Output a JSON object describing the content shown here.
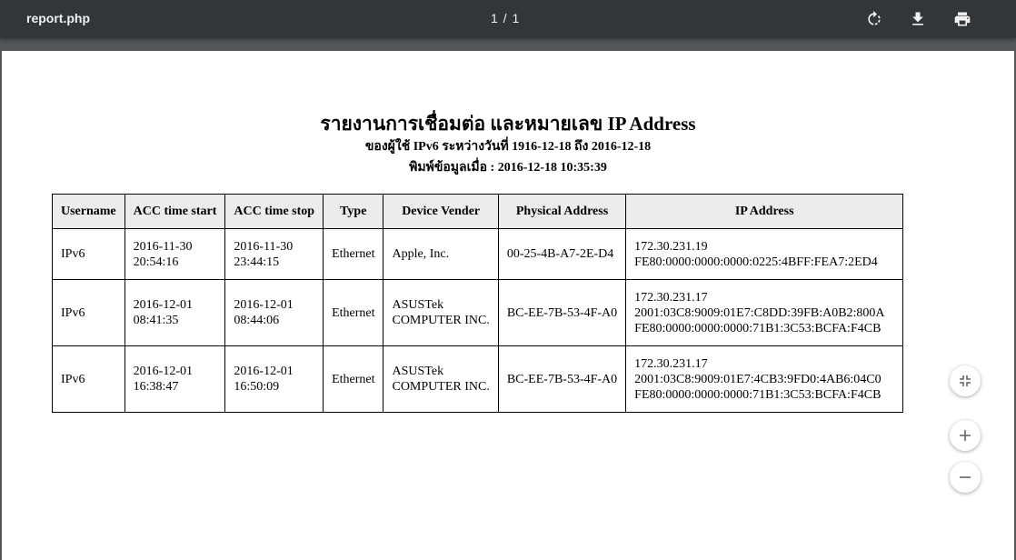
{
  "toolbar": {
    "title": "report.php",
    "page_indicator": "1 / 1",
    "rotate_icon": "rotate-icon",
    "download_icon": "download-icon",
    "print_icon": "print-icon"
  },
  "report": {
    "title": "รายงานการเชื่อมต่อ และหมายเลข IP Address",
    "subtitle": "ของผู้ใช้ IPv6 ระหว่างวันที่ 1916-12-18 ถึง 2016-12-18",
    "printed_at": "พิมพ์ข้อมูลเมื่อ : 2016-12-18 10:35:39"
  },
  "table": {
    "headers": [
      "Username",
      "ACC time start",
      "ACC time stop",
      "Type",
      "Device Vender",
      "Physical Address",
      "IP Address"
    ],
    "rows": [
      {
        "username": "IPv6",
        "start_date": "2016-11-30",
        "start_time": "20:54:16",
        "stop_date": "2016-11-30",
        "stop_time": "23:44:15",
        "type": "Ethernet",
        "vendor_line1": "Apple, Inc.",
        "vendor_line2": "",
        "mac": "00-25-4B-A7-2E-D4",
        "ip_line1": "172.30.231.19",
        "ip_line2": "FE80:0000:0000:0000:0225:4BFF:FEA7:2ED4",
        "ip_line3": ""
      },
      {
        "username": "IPv6",
        "start_date": "2016-12-01",
        "start_time": "08:41:35",
        "stop_date": "2016-12-01",
        "stop_time": "08:44:06",
        "type": "Ethernet",
        "vendor_line1": "ASUSTek",
        "vendor_line2": "COMPUTER INC.",
        "mac": "BC-EE-7B-53-4F-A0",
        "ip_line1": "172.30.231.17",
        "ip_line2": "2001:03C8:9009:01E7:C8DD:39FB:A0B2:800A",
        "ip_line3": "FE80:0000:0000:0000:71B1:3C53:BCFA:F4CB"
      },
      {
        "username": "IPv6",
        "start_date": "2016-12-01",
        "start_time": "16:38:47",
        "stop_date": "2016-12-01",
        "stop_time": "16:50:09",
        "type": "Ethernet",
        "vendor_line1": "ASUSTek",
        "vendor_line2": "COMPUTER INC.",
        "mac": "BC-EE-7B-53-4F-A0",
        "ip_line1": "172.30.231.17",
        "ip_line2": "2001:03C8:9009:01E7:4CB3:9FD0:4AB6:04C0",
        "ip_line3": "FE80:0000:0000:0000:71B1:3C53:BCFA:F4CB"
      }
    ]
  },
  "zoom_controls": {
    "fit_icon": "fit-to-page-icon",
    "zoom_in_icon": "plus-icon",
    "zoom_out_icon": "minus-icon"
  },
  "colors": {
    "toolbar_bg": "#323639",
    "viewer_bg": "#525659",
    "header_cell_bg": "#ececec"
  }
}
